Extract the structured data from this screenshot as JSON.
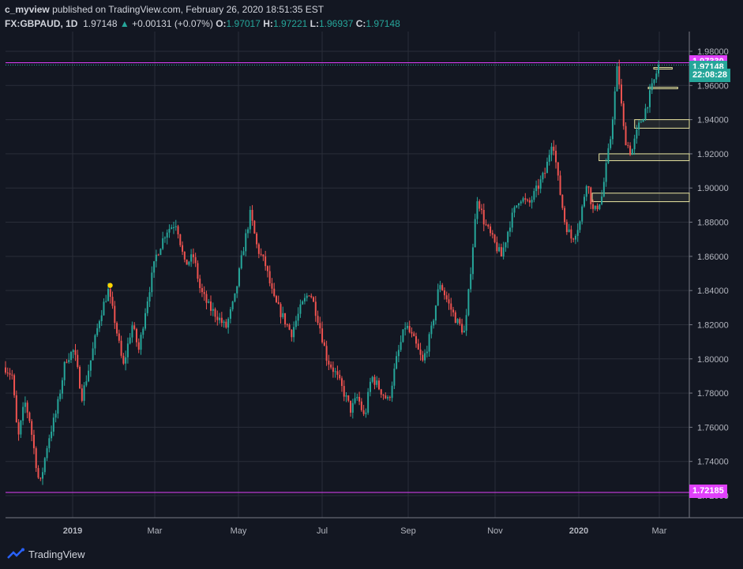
{
  "header": {
    "publisher": "c_myview",
    "published_text": "published on TradingView.com, February 26, 2020 18:51:35 EST",
    "symbol": "FX:GBPAUD, 1D",
    "last": "1.97148",
    "change": "+0.00131 (+0.07%)",
    "o_label": "O:",
    "o_value": "1.97017",
    "h_label": "H:",
    "h_value": "1.97221",
    "l_label": "L:",
    "l_value": "1.96937",
    "c_label": "C:",
    "c_value": "1.97148"
  },
  "footer": {
    "brand": "TradingView"
  },
  "colors": {
    "bg": "#131722",
    "up": "#26a69a",
    "down": "#ef5350",
    "magenta": "#e040fb",
    "zone": "#e8e4a0",
    "grid": "#2a2e39",
    "text": "#b2b5be"
  },
  "chart_data": {
    "type": "candlestick",
    "symbol": "FX:GBPAUD",
    "timeframe": "1D",
    "ylim": [
      1.72,
      1.985
    ],
    "y_ticks": [
      "1.98000",
      "1.96000",
      "1.94000",
      "1.92000",
      "1.90000",
      "1.88000",
      "1.86000",
      "1.84000",
      "1.82000",
      "1.80000",
      "1.78000",
      "1.76000",
      "1.74000",
      "1.72000"
    ],
    "x_ticks": [
      "2019",
      "Mar",
      "May",
      "Jul",
      "Sep",
      "Nov",
      "2020",
      "Mar"
    ],
    "price_labels": [
      {
        "text": "1.97330",
        "value": 1.9733,
        "kind": "magenta"
      },
      {
        "text": "1.97148",
        "value": 1.97148,
        "kind": "last"
      },
      {
        "text": "22:08:28",
        "value": 1.9688,
        "kind": "countdown"
      },
      {
        "text": "1.72185",
        "value": 1.72185,
        "kind": "magenta"
      }
    ],
    "horizontal_lines": [
      1.9733,
      1.72185
    ],
    "zones": [
      {
        "top": 1.9705,
        "bottom": 1.9702,
        "from": 0.948,
        "to": 0.975
      },
      {
        "top": 1.959,
        "bottom": 1.9582,
        "from": 0.94,
        "to": 0.983
      },
      {
        "top": 1.94,
        "bottom": 1.935,
        "from": 0.92,
        "to": 1.0
      },
      {
        "top": 1.92,
        "bottom": 1.916,
        "from": 0.868,
        "to": 1.0
      },
      {
        "top": 1.897,
        "bottom": 1.892,
        "from": 0.858,
        "to": 1.0
      }
    ],
    "marker": {
      "value": 1.843,
      "t": 0.153
    },
    "anchors": [
      [
        0.0,
        1.795
      ],
      [
        0.01,
        1.79
      ],
      [
        0.018,
        1.752
      ],
      [
        0.028,
        1.775
      ],
      [
        0.035,
        1.765
      ],
      [
        0.045,
        1.738
      ],
      [
        0.05,
        1.725
      ],
      [
        0.062,
        1.752
      ],
      [
        0.075,
        1.77
      ],
      [
        0.088,
        1.8
      ],
      [
        0.1,
        1.805
      ],
      [
        0.112,
        1.778
      ],
      [
        0.125,
        1.8
      ],
      [
        0.138,
        1.825
      ],
      [
        0.15,
        1.84
      ],
      [
        0.16,
        1.822
      ],
      [
        0.172,
        1.795
      ],
      [
        0.185,
        1.82
      ],
      [
        0.195,
        1.805
      ],
      [
        0.205,
        1.83
      ],
      [
        0.22,
        1.86
      ],
      [
        0.235,
        1.875
      ],
      [
        0.25,
        1.88
      ],
      [
        0.262,
        1.855
      ],
      [
        0.275,
        1.86
      ],
      [
        0.285,
        1.84
      ],
      [
        0.298,
        1.83
      ],
      [
        0.31,
        1.825
      ],
      [
        0.322,
        1.818
      ],
      [
        0.335,
        1.835
      ],
      [
        0.348,
        1.865
      ],
      [
        0.358,
        1.885
      ],
      [
        0.368,
        1.865
      ],
      [
        0.38,
        1.855
      ],
      [
        0.392,
        1.835
      ],
      [
        0.405,
        1.825
      ],
      [
        0.418,
        1.815
      ],
      [
        0.432,
        1.83
      ],
      [
        0.445,
        1.84
      ],
      [
        0.458,
        1.822
      ],
      [
        0.47,
        1.8
      ],
      [
        0.482,
        1.792
      ],
      [
        0.495,
        1.78
      ],
      [
        0.505,
        1.77
      ],
      [
        0.515,
        1.778
      ],
      [
        0.525,
        1.765
      ],
      [
        0.535,
        1.79
      ],
      [
        0.548,
        1.782
      ],
      [
        0.56,
        1.775
      ],
      [
        0.572,
        1.8
      ],
      [
        0.585,
        1.82
      ],
      [
        0.598,
        1.81
      ],
      [
        0.61,
        1.798
      ],
      [
        0.622,
        1.815
      ],
      [
        0.635,
        1.845
      ],
      [
        0.648,
        1.832
      ],
      [
        0.66,
        1.822
      ],
      [
        0.672,
        1.815
      ],
      [
        0.682,
        1.86
      ],
      [
        0.69,
        1.895
      ],
      [
        0.7,
        1.88
      ],
      [
        0.712,
        1.87
      ],
      [
        0.725,
        1.86
      ],
      [
        0.738,
        1.88
      ],
      [
        0.752,
        1.895
      ],
      [
        0.765,
        1.89
      ],
      [
        0.778,
        1.9
      ],
      [
        0.79,
        1.91
      ],
      [
        0.8,
        1.93
      ],
      [
        0.808,
        1.905
      ],
      [
        0.818,
        1.88
      ],
      [
        0.828,
        1.87
      ],
      [
        0.84,
        1.88
      ],
      [
        0.85,
        1.905
      ],
      [
        0.86,
        1.885
      ],
      [
        0.872,
        1.895
      ],
      [
        0.885,
        1.93
      ],
      [
        0.895,
        1.972
      ],
      [
        0.905,
        1.93
      ],
      [
        0.915,
        1.92
      ],
      [
        0.925,
        1.935
      ],
      [
        0.935,
        1.945
      ],
      [
        0.948,
        1.962
      ],
      [
        0.955,
        1.9715
      ]
    ]
  }
}
